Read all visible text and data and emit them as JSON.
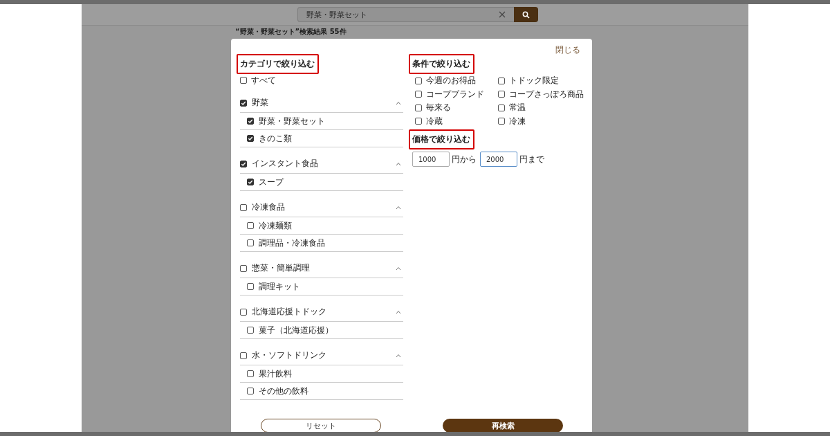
{
  "header": {
    "search": {
      "value": "野菜・野菜セット"
    },
    "result_summary": "“野菜・野菜セット”検索結果 55件"
  },
  "modal": {
    "close_link": "閉じる",
    "category_filter": {
      "title": "カテゴリで絞り込む",
      "all": {
        "label": "すべて",
        "checked": false
      },
      "groups": [
        {
          "label": "野菜",
          "checked": true,
          "expanded": true,
          "children": [
            {
              "label": "野菜・野菜セット",
              "checked": true
            },
            {
              "label": "きのこ類",
              "checked": true
            }
          ]
        },
        {
          "label": "インスタント食品",
          "checked": true,
          "expanded": true,
          "children": [
            {
              "label": "スープ",
              "checked": true
            }
          ]
        },
        {
          "label": "冷凍食品",
          "checked": false,
          "expanded": true,
          "children": [
            {
              "label": "冷凍麺類",
              "checked": false
            },
            {
              "label": "調理品・冷凍食品",
              "checked": false
            }
          ]
        },
        {
          "label": "惣菜・簡単調理",
          "checked": false,
          "expanded": true,
          "children": [
            {
              "label": "調理キット",
              "checked": false
            }
          ]
        },
        {
          "label": "北海道応援トドック",
          "checked": false,
          "expanded": true,
          "children": [
            {
              "label": "菓子（北海道応援）",
              "checked": false
            }
          ]
        },
        {
          "label": "水・ソフトドリンク",
          "checked": false,
          "expanded": true,
          "children": [
            {
              "label": "果汁飲料",
              "checked": false
            },
            {
              "label": "その他の飲料",
              "checked": false
            }
          ]
        }
      ]
    },
    "condition_filter": {
      "title": "条件で絞り込む",
      "options": [
        {
          "label": "今週のお得品",
          "checked": false
        },
        {
          "label": "トドック限定",
          "checked": false
        },
        {
          "label": "コープブランド",
          "checked": false
        },
        {
          "label": "コープさっぽろ商品",
          "checked": false
        },
        {
          "label": "毎来る",
          "checked": false
        },
        {
          "label": "常温",
          "checked": false
        },
        {
          "label": "冷蔵",
          "checked": false
        },
        {
          "label": "冷凍",
          "checked": false
        }
      ]
    },
    "price_filter": {
      "title": "価格で絞り込む",
      "min": {
        "value": "1000",
        "focused": false
      },
      "min_suffix": "円から",
      "max": {
        "value": "2000",
        "focused": true
      },
      "max_suffix": "円まで"
    },
    "buttons": {
      "reset": "リセット",
      "search": "再検索"
    }
  }
}
